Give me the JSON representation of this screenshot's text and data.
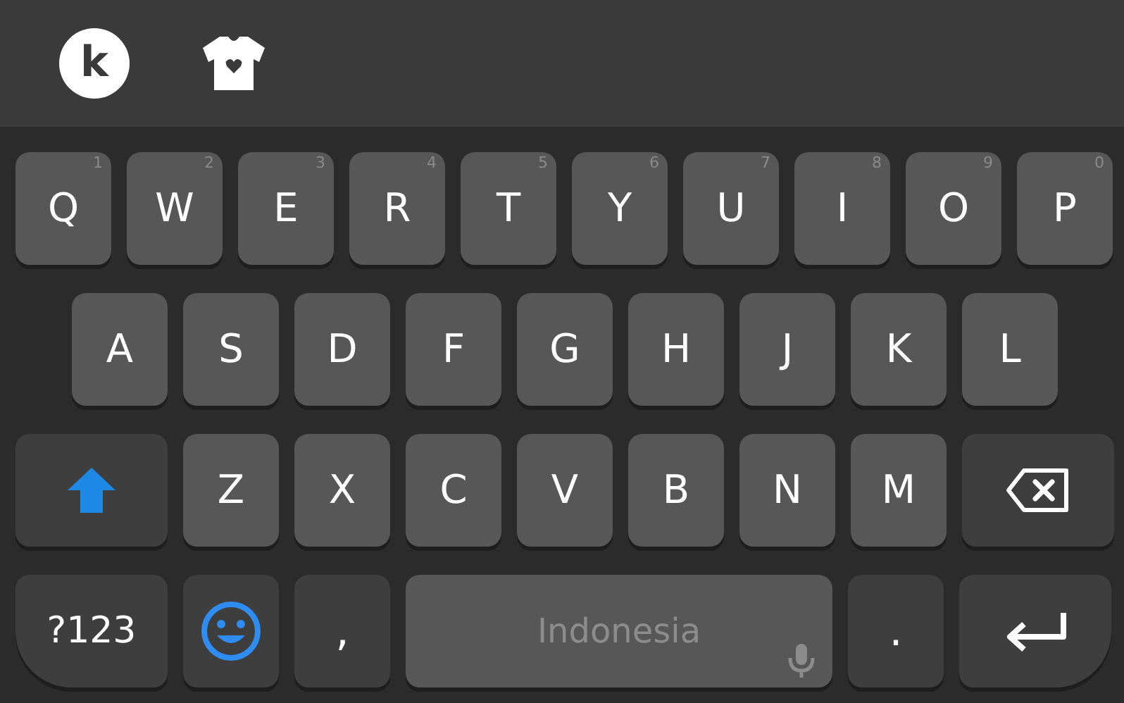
{
  "toolbar": {
    "items": [
      {
        "kind": "logo",
        "label": "k"
      },
      {
        "kind": "theme"
      }
    ]
  },
  "rows": [
    [
      {
        "kind": "letter",
        "label": "Q",
        "hint": "1"
      },
      {
        "kind": "letter",
        "label": "W",
        "hint": "2"
      },
      {
        "kind": "letter",
        "label": "E",
        "hint": "3"
      },
      {
        "kind": "letter",
        "label": "R",
        "hint": "4"
      },
      {
        "kind": "letter",
        "label": "T",
        "hint": "5"
      },
      {
        "kind": "letter",
        "label": "Y",
        "hint": "6"
      },
      {
        "kind": "letter",
        "label": "U",
        "hint": "7"
      },
      {
        "kind": "letter",
        "label": "I",
        "hint": "8"
      },
      {
        "kind": "letter",
        "label": "O",
        "hint": "9"
      },
      {
        "kind": "letter",
        "label": "P",
        "hint": "0"
      }
    ],
    [
      {
        "kind": "letter",
        "label": "A"
      },
      {
        "kind": "letter",
        "label": "S"
      },
      {
        "kind": "letter",
        "label": "D"
      },
      {
        "kind": "letter",
        "label": "F"
      },
      {
        "kind": "letter",
        "label": "G"
      },
      {
        "kind": "letter",
        "label": "H"
      },
      {
        "kind": "letter",
        "label": "J"
      },
      {
        "kind": "letter",
        "label": "K"
      },
      {
        "kind": "letter",
        "label": "L"
      }
    ],
    [
      {
        "kind": "shift",
        "on": true
      },
      {
        "kind": "letter",
        "label": "Z"
      },
      {
        "kind": "letter",
        "label": "X"
      },
      {
        "kind": "letter",
        "label": "C"
      },
      {
        "kind": "letter",
        "label": "V"
      },
      {
        "kind": "letter",
        "label": "B"
      },
      {
        "kind": "letter",
        "label": "N"
      },
      {
        "kind": "letter",
        "label": "M"
      },
      {
        "kind": "backspace"
      }
    ],
    [
      {
        "kind": "symbols",
        "label": "?123"
      },
      {
        "kind": "emoji"
      },
      {
        "kind": "punct",
        "label": ","
      },
      {
        "kind": "space",
        "label": "Indonesia"
      },
      {
        "kind": "punct",
        "label": "."
      },
      {
        "kind": "enter"
      }
    ]
  ]
}
